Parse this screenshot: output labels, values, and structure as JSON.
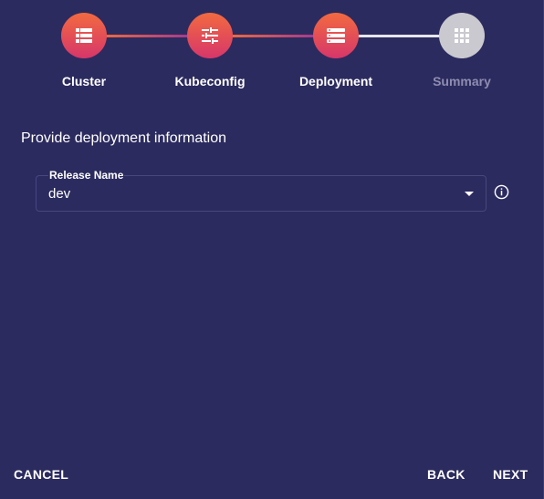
{
  "stepper": {
    "steps": [
      {
        "label": "Cluster",
        "icon": "list-icon",
        "state": "active"
      },
      {
        "label": "Kubeconfig",
        "icon": "sliders-icon",
        "state": "active"
      },
      {
        "label": "Deployment",
        "icon": "server-icon",
        "state": "active"
      },
      {
        "label": "Summary",
        "icon": "grid-icon",
        "state": "inactive"
      }
    ]
  },
  "section": {
    "title": "Provide deployment information"
  },
  "release_name": {
    "label": "Release Name",
    "value": "dev",
    "info_icon": "info-icon"
  },
  "footer": {
    "cancel_label": "CANCEL",
    "back_label": "BACK",
    "next_label": "NEXT"
  },
  "colors": {
    "background": "#2c2b5f",
    "step_active_top": "#f26a3f",
    "step_active_bottom": "#d7366a",
    "step_inactive": "#c9c9cf",
    "label_muted": "#8e8db0"
  }
}
